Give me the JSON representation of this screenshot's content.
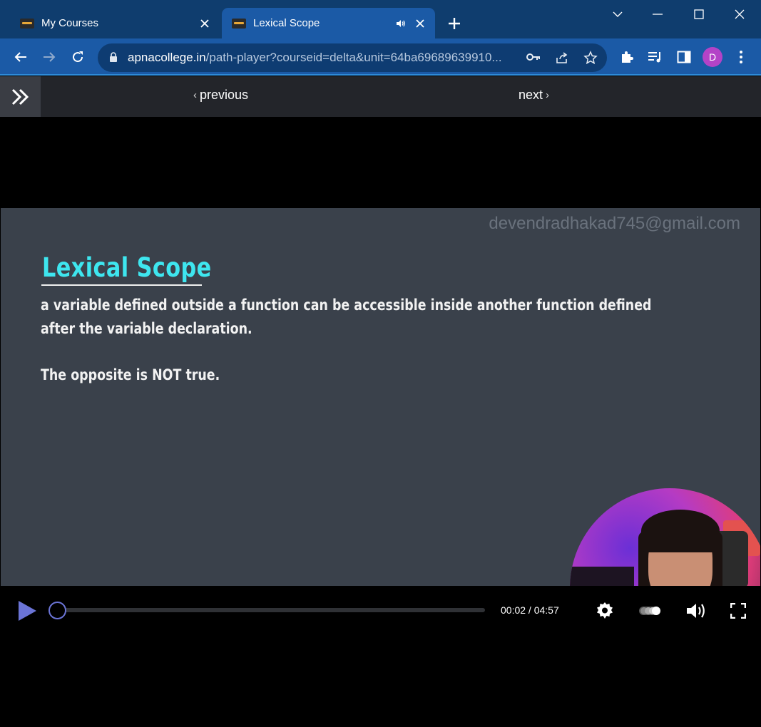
{
  "browser": {
    "tabs": [
      {
        "title": "My Courses",
        "active": false
      },
      {
        "title": "Lexical Scope",
        "active": true
      }
    ],
    "url_host": "apnacollege.in",
    "url_path": "/path-player?courseid=delta&unit=64ba69689639910...",
    "profile_initial": "D",
    "accent_color": "#1b5aa6"
  },
  "page_nav": {
    "previous_label": "previous",
    "next_label": "next"
  },
  "slide": {
    "watermark": "devendradhakad745@gmail.com",
    "title": "Lexical Scope",
    "line1": "a variable defined outside a function can be accessible inside another function defined",
    "line2": "after the variable declaration.",
    "line3": "The opposite is NOT true.",
    "title_color": "#3ee6ef"
  },
  "player": {
    "current_time": "00:02",
    "duration": "04:57",
    "time_display": "00:02 / 04:57",
    "progress_fraction": 0.007,
    "accent_color": "#6b74d6"
  }
}
